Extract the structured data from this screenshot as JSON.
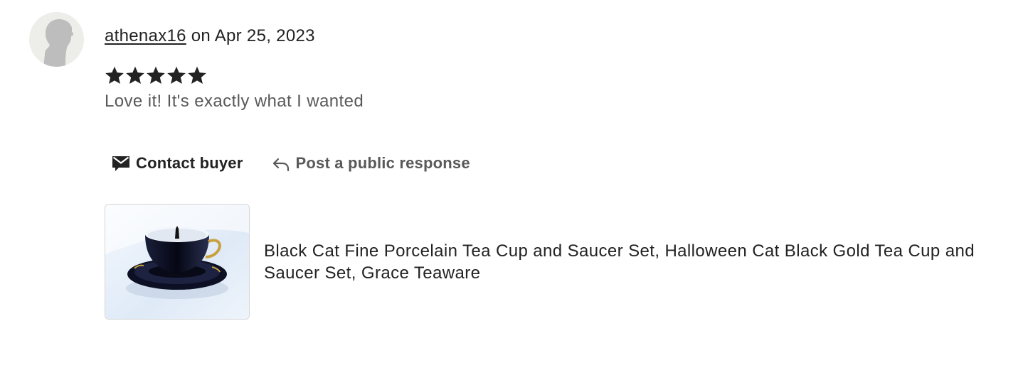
{
  "review": {
    "username": "athenax16",
    "date_text": "on Apr 25, 2023",
    "rating": 5,
    "rating_max": 5,
    "text": "Love it! It's exactly what I wanted"
  },
  "actions": {
    "contact_label": "Contact buyer",
    "respond_label": "Post a public response"
  },
  "product": {
    "title": "Black Cat Fine Porcelain Tea Cup and Saucer Set, Halloween Cat Black Gold Tea Cup and Saucer Set, Grace Teaware"
  },
  "icons": {
    "avatar": "person-silhouette-icon",
    "star": "star-icon",
    "contact": "envelope-icon",
    "respond": "reply-arrow-icon"
  },
  "colors": {
    "text_primary": "#222222",
    "text_secondary": "#595959",
    "avatar_bg": "#ededea",
    "star": "#222222"
  }
}
